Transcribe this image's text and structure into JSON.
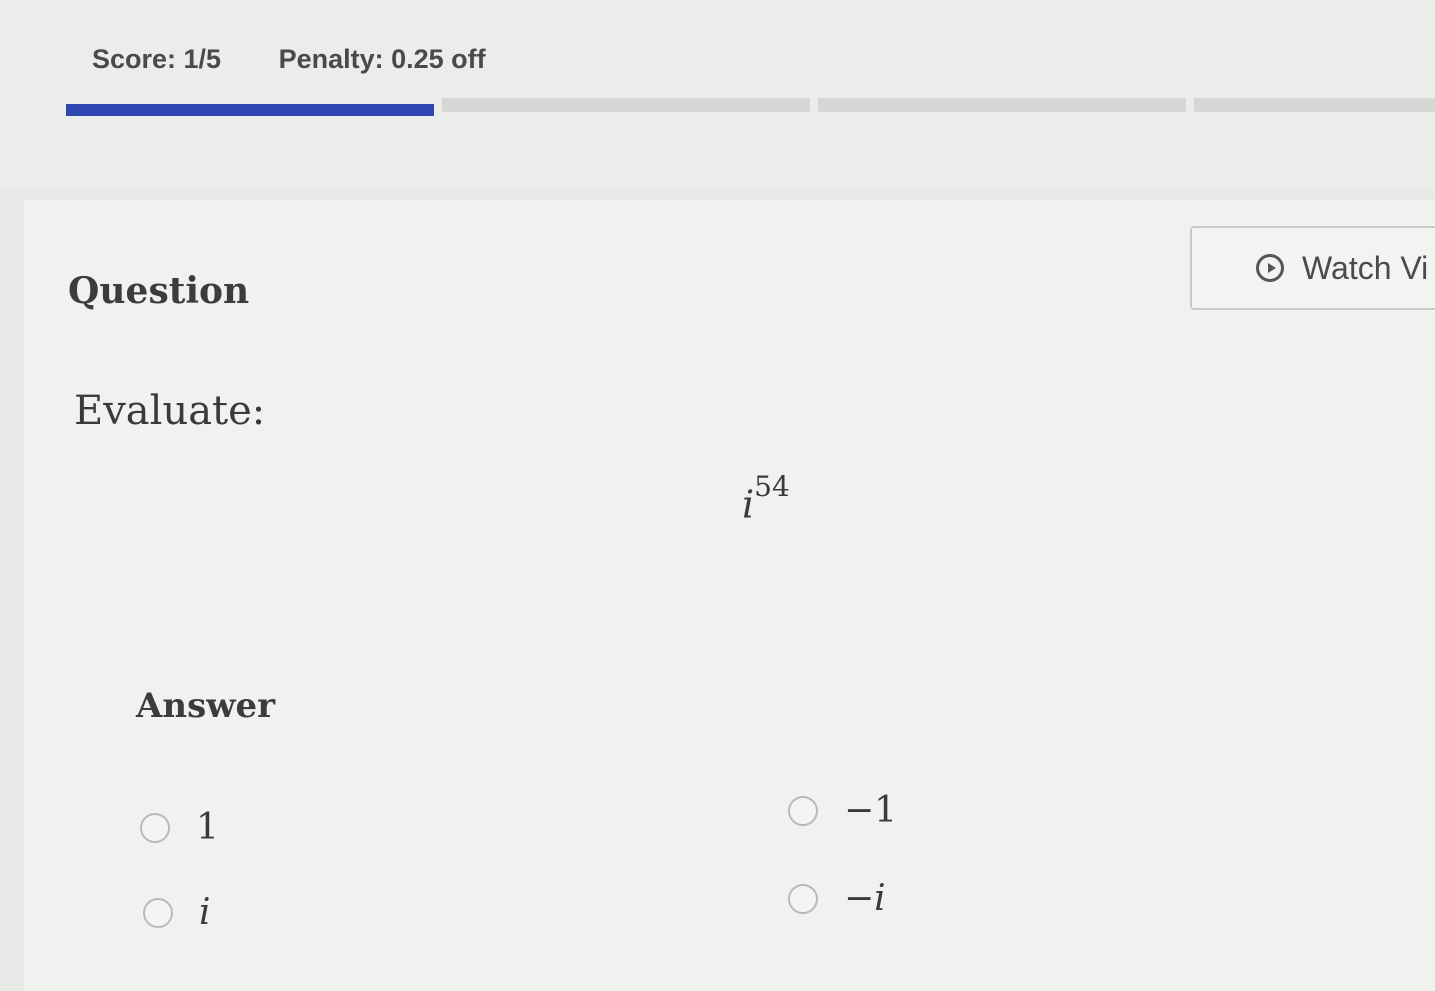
{
  "header": {
    "score": "Score: 1/5",
    "penalty": "Penalty: 0.25 off",
    "progress": {
      "completed": 1,
      "total": 5
    },
    "colors": {
      "progress_done": "#2f47b0",
      "progress_pending": "#d6d6d4"
    }
  },
  "question": {
    "title": "Question",
    "watch_video_label": "Watch Vi",
    "watch_video_icon": "play-circle-icon",
    "prompt": "Evaluate:",
    "expression": {
      "base": "i",
      "exponent": "54"
    }
  },
  "answer": {
    "title": "Answer",
    "options": [
      {
        "label": "1"
      },
      {
        "label": "−1"
      },
      {
        "label": "i"
      },
      {
        "label": "−i"
      }
    ]
  }
}
